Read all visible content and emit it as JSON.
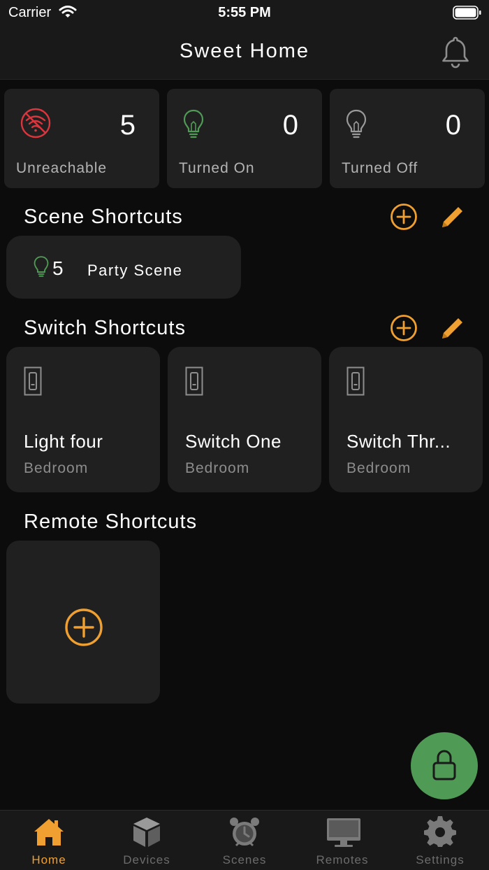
{
  "status_bar": {
    "carrier": "Carrier",
    "time": "5:55 PM"
  },
  "header": {
    "title": "Sweet Home"
  },
  "stats": [
    {
      "label": "Unreachable",
      "value": "5",
      "icon": "wifi-off-icon"
    },
    {
      "label": "Turned On",
      "value": "0",
      "icon": "bulb-on-icon"
    },
    {
      "label": "Turned Off",
      "value": "0",
      "icon": "bulb-off-icon"
    }
  ],
  "scene_shortcuts": {
    "title": "Scene Shortcuts",
    "items": [
      {
        "count": "5",
        "name": "Party Scene"
      }
    ]
  },
  "switch_shortcuts": {
    "title": "Switch Shortcuts",
    "items": [
      {
        "name": "Light four",
        "room": "Bedroom"
      },
      {
        "name": "Switch One",
        "room": "Bedroom"
      },
      {
        "name": "Switch Thr...",
        "room": "Bedroom"
      }
    ]
  },
  "remote_shortcuts": {
    "title": "Remote Shortcuts"
  },
  "tabs": [
    {
      "label": "Home",
      "icon": "home-icon",
      "active": true
    },
    {
      "label": "Devices",
      "icon": "cube-icon",
      "active": false
    },
    {
      "label": "Scenes",
      "icon": "alarm-clock-icon",
      "active": false
    },
    {
      "label": "Remotes",
      "icon": "monitor-icon",
      "active": false
    },
    {
      "label": "Settings",
      "icon": "gear-icon",
      "active": false
    }
  ],
  "colors": {
    "accent": "#f0a030",
    "on_green": "#4f9a55",
    "unreachable_red": "#d9363e",
    "card": "#202020",
    "background": "#0c0c0c"
  }
}
